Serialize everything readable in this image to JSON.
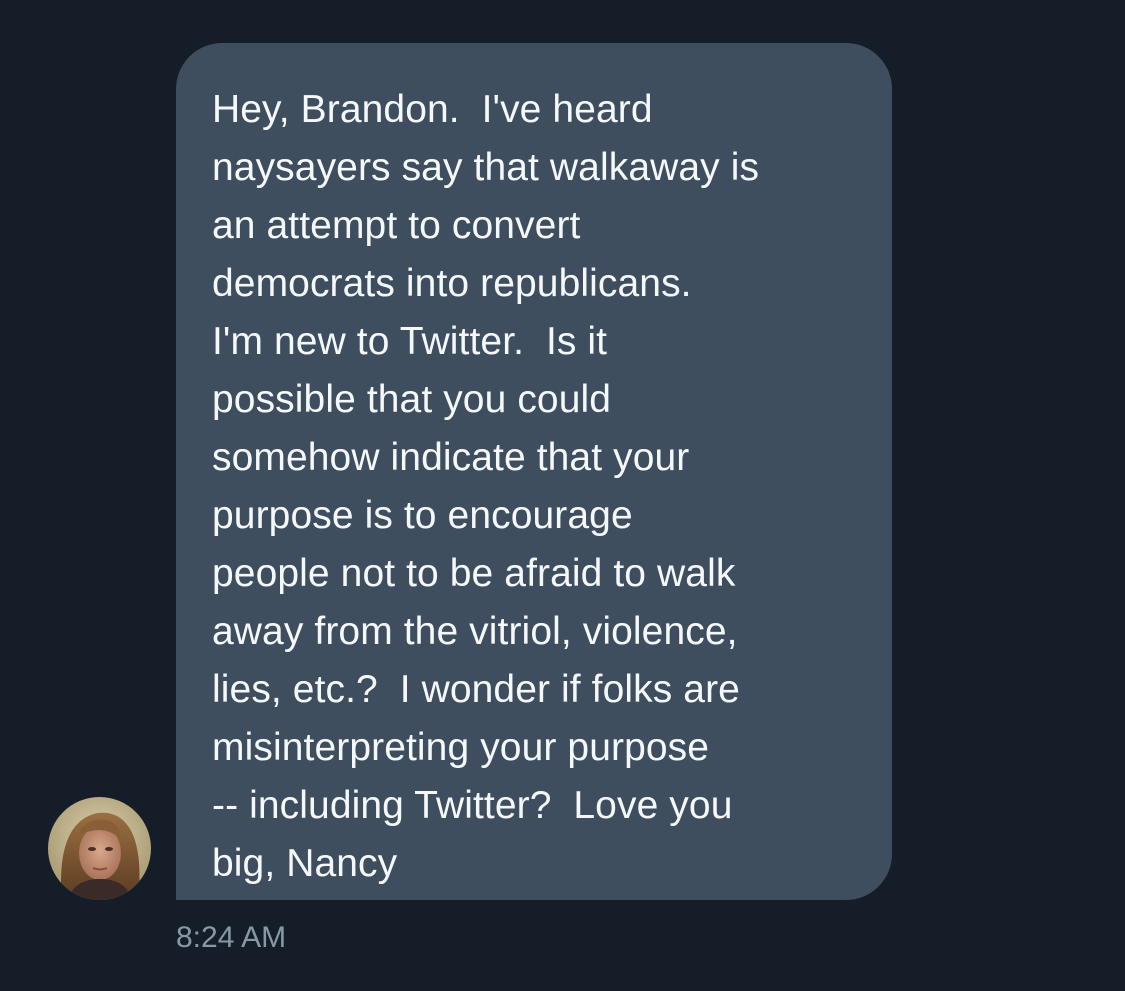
{
  "conversation": {
    "message": {
      "lines": [
        "Hey, Brandon.  I've heard",
        "naysayers say that walkaway is",
        "an attempt to convert",
        "democrats into republicans.",
        "I'm new to Twitter.  Is it",
        "possible that you could",
        "somehow indicate that your",
        "purpose is to encourage",
        "people not to be afraid to walk",
        "away from the vitriol, violence,",
        "lies, etc.?  I wonder if folks are",
        "misinterpreting your purpose",
        "-- including Twitter?  Love you",
        "big, Nancy"
      ],
      "timestamp": "8:24 AM"
    },
    "sender": {
      "avatar_icon": "user-avatar-photo"
    }
  },
  "colors": {
    "background": "#151d28",
    "bubble": "#3e4e5e",
    "message_text": "#f5f8fa",
    "timestamp": "#8899a6"
  }
}
